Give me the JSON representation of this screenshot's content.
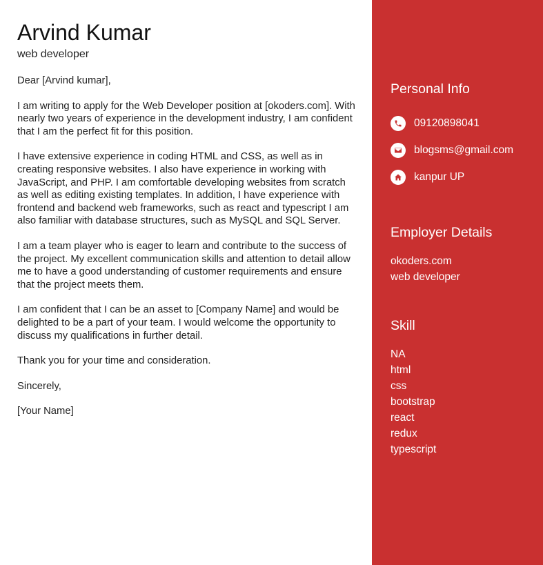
{
  "header": {
    "name": "Arvind Kumar",
    "role": "web developer"
  },
  "letter": {
    "greeting": "Dear [Arvind kumar],",
    "paragraphs": [
      "I am writing to apply for the Web Developer position at [okoders.com]. With nearly two years of experience in the development industry, I am confident that I am the perfect fit for this position.",
      "I have extensive experience in coding HTML and CSS, as well as in creating responsive websites. I also have experience in working with JavaScript, and PHP. I am comfortable developing websites from scratch as well as editing existing templates. In addition, I have experience with frontend and backend web frameworks, such as react and typescript I am also familiar with database structures, such as MySQL and SQL Server.",
      "I am a team player who is eager to learn and contribute to the success of the project. My excellent communication skills and attention to detail allow me to have a good understanding of customer requirements and ensure that the project meets them.",
      "I am confident that I can be an asset to [Company Name] and would be delighted to be a part of your team. I would welcome the opportunity to discuss my qualifications in further detail.",
      "Thank you for your time and consideration."
    ],
    "closing": "Sincerely,",
    "signature": "[Your Name]"
  },
  "sidebar": {
    "personal_heading": "Personal Info",
    "contacts": [
      {
        "icon": "phone-icon",
        "text": "09120898041"
      },
      {
        "icon": "envelope-icon",
        "text": "blogsms@gmail.com"
      },
      {
        "icon": "home-icon",
        "text": "kanpur UP"
      }
    ],
    "employer_heading": "Employer Details",
    "employer": [
      "okoders.com",
      "web developer"
    ],
    "skill_heading": "Skill",
    "skills": [
      "NA",
      "html",
      "css",
      "bootstrap",
      "react",
      "redux",
      "typescript"
    ]
  },
  "colors": {
    "sidebar_bg": "#c93030",
    "icon_fg": "#c93030",
    "text_dark": "#222222"
  }
}
